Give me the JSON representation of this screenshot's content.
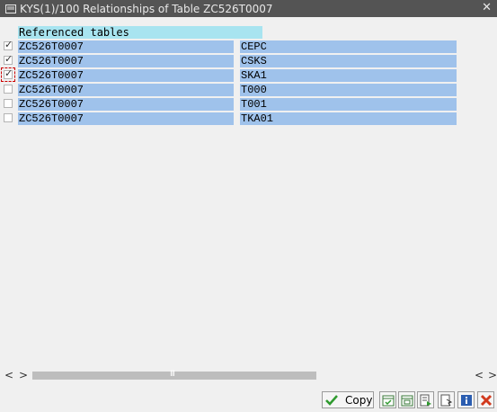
{
  "window": {
    "title": "KYS(1)/100 Relationships of Table ZC526T0007",
    "icon": "window-menu-icon",
    "close_icon": "close-icon"
  },
  "table": {
    "header": "Referenced tables",
    "rows": [
      {
        "checked": true,
        "table": "ZC526T0007",
        "ref_table": "CEPC"
      },
      {
        "checked": true,
        "table": "ZC526T0007",
        "ref_table": "CSKS"
      },
      {
        "checked": true,
        "table": "ZC526T0007",
        "ref_table": "SKA1"
      },
      {
        "checked": false,
        "table": "ZC526T0007",
        "ref_table": "T000"
      },
      {
        "checked": false,
        "table": "ZC526T0007",
        "ref_table": "T001"
      },
      {
        "checked": false,
        "table": "ZC526T0007",
        "ref_table": "TKA01"
      }
    ]
  },
  "scrollbar": {
    "left_prev": "<",
    "left_next": ">",
    "right_prev": "<",
    "right_next": ">",
    "grip": "III"
  },
  "toolbar": {
    "copy_label": "Copy",
    "buttons": [
      "select-all-icon",
      "deselect-all-icon",
      "select-block-icon",
      "detail-icon",
      "info-icon",
      "cancel-icon"
    ]
  },
  "colors": {
    "title_bar": "#545454",
    "row_bg": "#9fc2eb",
    "header_bg": "#a8e4f0",
    "window_bg": "#f0f0f0",
    "cancel_red": "#d23a1e",
    "ok_green": "#2f9a2f"
  }
}
